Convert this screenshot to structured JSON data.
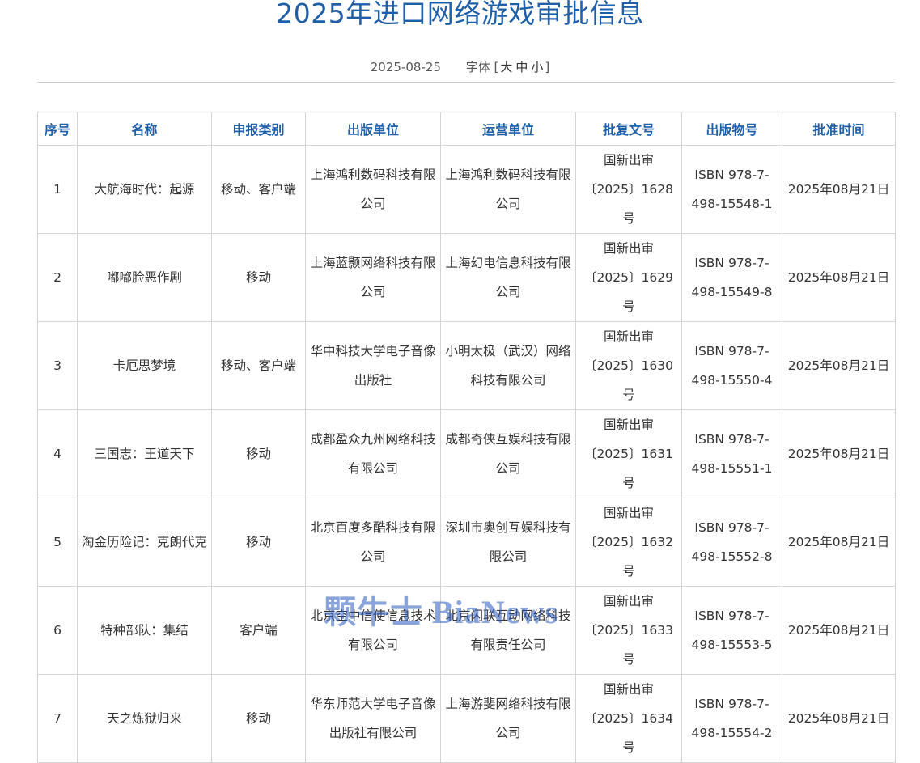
{
  "page_title": "2025年进口网络游戏审批信息",
  "meta": {
    "date": "2025-08-25",
    "font_label": "字体",
    "bracket_open": "[",
    "size_large": "大",
    "size_medium": "中",
    "size_small": "小",
    "bracket_close": "]"
  },
  "table": {
    "headers": [
      "序号",
      "名称",
      "申报类别",
      "出版单位",
      "运营单位",
      "批复文号",
      "出版物号",
      "批准时间"
    ],
    "rows": [
      [
        "1",
        "大航海时代：起源",
        "移动、客户端",
        "上海鸿利数码科技有限公司",
        "上海鸿利数码科技有限公司",
        "国新出审〔2025〕1628号",
        "ISBN 978-7-498-15548-1",
        "2025年08月21日"
      ],
      [
        "2",
        "嘟嘟脸恶作剧",
        "移动",
        "上海蓝颢网络科技有限公司",
        "上海幻电信息科技有限公司",
        "国新出审〔2025〕1629号",
        "ISBN 978-7-498-15549-8",
        "2025年08月21日"
      ],
      [
        "3",
        "卡厄思梦境",
        "移动、客户端",
        "华中科技大学电子音像出版社",
        "小明太极（武汉）网络科技有限公司",
        "国新出审〔2025〕1630号",
        "ISBN 978-7-498-15550-4",
        "2025年08月21日"
      ],
      [
        "4",
        "三国志：王道天下",
        "移动",
        "成都盈众九州网络科技有限公司",
        "成都奇侠互娱科技有限公司",
        "国新出审〔2025〕1631号",
        "ISBN 978-7-498-15551-1",
        "2025年08月21日"
      ],
      [
        "5",
        "淘金历险记：克朗代克",
        "移动",
        "北京百度多酷科技有限公司",
        "深圳市奥创互娱科技有限公司",
        "国新出审〔2025〕1632号",
        "ISBN 978-7-498-15552-8",
        "2025年08月21日"
      ],
      [
        "6",
        "特种部队：集结",
        "客户端",
        "北京空中信使信息技术有限公司",
        "北京闪联互动网络科技有限责任公司",
        "国新出审〔2025〕1633号",
        "ISBN 978-7-498-15553-5",
        "2025年08月21日"
      ],
      [
        "7",
        "天之炼狱归来",
        "移动",
        "华东师范大学电子音像出版社有限公司",
        "上海游斐网络科技有限公司",
        "国新出审〔2025〕1634号",
        "ISBN 978-7-498-15554-2",
        "2025年08月21日"
      ]
    ]
  },
  "watermark": "颗牛士 BiaNews"
}
